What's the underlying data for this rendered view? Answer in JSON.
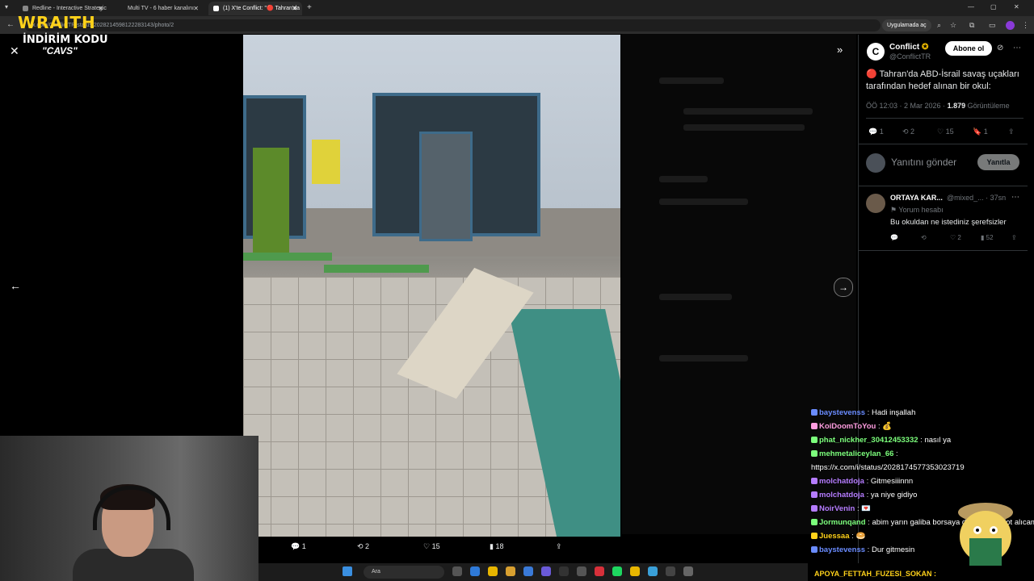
{
  "browser": {
    "tabs": [
      {
        "label": "Redline - Interactive Strategic M"
      },
      {
        "label": "Multi TV - 6 haber kanalını"
      },
      {
        "label": "(1) X'te Conflict: \"🔴 Tahran'da"
      }
    ],
    "url": "x.com/ConflictTR/status/2028214598122283143/photo/2",
    "app_chip": "Uygulamada aç"
  },
  "overlay": {
    "brand": "WRAITH",
    "promo_line": "İNDİRİM KODU",
    "promo_code": "\"CAVS\""
  },
  "tweet": {
    "author_name": "Conflict",
    "author_handle": "@ConflictTR",
    "follow_label": "Abone ol",
    "text": "🔴 Tahran'da ABD-İsrail savaş uçakları tarafından hedef alınan bir okul:",
    "time": "ÖÖ 12:03 · 2 Mar 2026 ·",
    "views_count": "1.879",
    "views_label": "Görüntüleme",
    "replies": "1",
    "retweets": "2",
    "likes": "15",
    "bookmarks": "1",
    "reply_placeholder": "Yanıtını gönder",
    "reply_button": "Yanıtla"
  },
  "photo_actions": {
    "replies": "1",
    "retweets": "2",
    "likes": "15",
    "views": "18"
  },
  "reply": {
    "name": "ORTAYA KAR...",
    "handle": "@mixed_... · 37sn",
    "subtitle": "Yorum hesabı",
    "text": "Bu okuldan ne istediniz şerefsizler",
    "likes": "2",
    "views": "52"
  },
  "chat": [
    {
      "user": "baystevenss",
      "color": "#6a8cff",
      "msg": "Hadi inşallah"
    },
    {
      "user": "KoiDoomToYou",
      "color": "#ff9de0",
      "msg": "💰"
    },
    {
      "user": "phat_nickher_30412453332",
      "color": "#7cff7c",
      "msg": "nasıl ya"
    },
    {
      "user": "mehmetaliceylan_66",
      "color": "#7cff7c",
      "msg": ""
    },
    {
      "user": "",
      "color": "#ffffff",
      "msg": "https://x.com/i/status/2028174577353023719"
    },
    {
      "user": "molchatdoja",
      "color": "#b57cff",
      "msg": "Gitmesiiinnn"
    },
    {
      "user": "molchatdoja",
      "color": "#b57cff",
      "msg": "ya niye gidiyo"
    },
    {
      "user": "NoirVenin",
      "color": "#b57cff",
      "msg": "💌"
    },
    {
      "user": "Jormunqand",
      "color": "#7cff7c",
      "msg": "abim yarın galiba borsaya dom... satıp lot alıcam @cavs"
    },
    {
      "user": "Juessaa",
      "color": "#ffd21a",
      "msg": "🥯"
    },
    {
      "user": "baystevenss",
      "color": "#6a8cff",
      "msg": "Dur gitmesin"
    }
  ],
  "taskbar": {
    "search_placeholder": "Ara"
  },
  "ticker": "APOYA_FETTAH_FUZESI_SOKAN :"
}
